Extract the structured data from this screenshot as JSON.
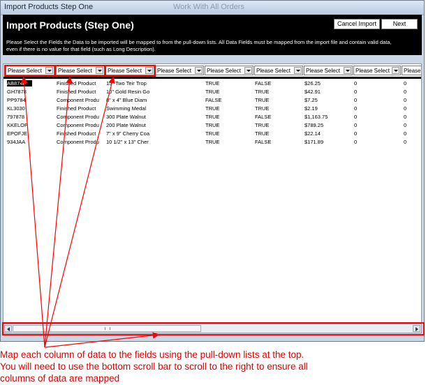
{
  "window": {
    "title": "Import Products Step One",
    "background_title": "Work With All Orders"
  },
  "panel": {
    "title": "Import Products (Step One)",
    "cancel_label": "Cancel Import",
    "next_label": "Next",
    "description": "Please Select the Fields the Data to be imported will be mapped to from the pull-down lists.  All Data Fields must be mapped from the import file and contain valid data, even if there is no value for that field (such as Long Description)."
  },
  "grid": {
    "selects": [
      "Please Select",
      "Please Select",
      "Please Select",
      "Please Select",
      "Please Select",
      "Please Select",
      "Please Select",
      "Please Select",
      "Please"
    ],
    "rows": [
      [
        "AB874F",
        "Finished Product",
        "15\" Two Teir Trop",
        "TRUE",
        "FALSE",
        "$26.25",
        "0",
        "0"
      ],
      [
        "GH7878",
        "Finished Product",
        "10\" Gold Resin Go",
        "TRUE",
        "TRUE",
        "$42.91",
        "0",
        "0"
      ],
      [
        "PP9784",
        "Component Produ",
        "8\" x 4\" Blue Diam",
        "FALSE",
        "TRUE",
        "$7.25",
        "0",
        "0"
      ],
      [
        "KL3030",
        "Finished Product",
        "Swimming Medal",
        "TRUE",
        "TRUE",
        "$2.19",
        "0",
        "0"
      ],
      [
        "797878",
        "Component Produ",
        "300 Plate Walnut",
        "TRUE",
        "FALSE",
        "$1,163.75",
        "0",
        "0"
      ],
      [
        "KKELOP",
        "Component Produ",
        "200 Plate Walnut",
        "TRUE",
        "TRUE",
        "$789.25",
        "0",
        "0"
      ],
      [
        "EPOFJE",
        "Finished Product",
        "7\" x 9\" Cherry Coa",
        "TRUE",
        "TRUE",
        "$22.14",
        "0",
        "0"
      ],
      [
        "934JAA",
        "Component Produ",
        "10 1/2\" x 13\" Cher",
        "TRUE",
        "FALSE",
        "$171.89",
        "0",
        "0"
      ]
    ]
  },
  "annotation": {
    "line1": "Map each column of data to the fields using the pull-down lists at the top.",
    "line2": "You will need to use the bottom scroll bar to scroll to the right to ensure all",
    "line3": "columns of data are mapped"
  },
  "colors": {
    "annotation_red": "#ff0000",
    "panel_black": "#000000",
    "window_blue": "#c9d7e6"
  }
}
